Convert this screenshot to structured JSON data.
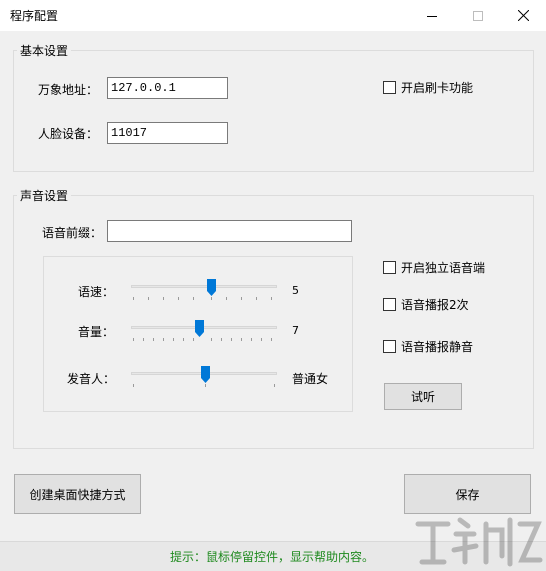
{
  "window": {
    "title": "程序配置"
  },
  "basic": {
    "group_title": "基本设置",
    "address_label": "万象地址：",
    "address_value": "127.0.0.1",
    "face_label": "人脸设备：",
    "face_value": "11017",
    "card_checkbox_label": "开启刷卡功能"
  },
  "sound": {
    "group_title": "声音设置",
    "prefix_label": "语音前缀：",
    "prefix_value": "",
    "speed_label": "语速：",
    "speed_value": "5",
    "volume_label": "音量：",
    "volume_value": "7",
    "voice_label": "发音人：",
    "voice_value": "普通女",
    "independent_label": "开启独立语音端",
    "twice_label": "语音播报2次",
    "mute_label": "语音播报静音",
    "listen_button": "试听"
  },
  "actions": {
    "shortcut_button": "创建桌面快捷方式",
    "save_button": "保存"
  },
  "status": {
    "hint": "提示：鼠标停留控件，显示帮助内容。"
  },
  "colors": {
    "accent": "#0078d7",
    "hint": "#1f8a1f",
    "background": "#f0f0f0"
  },
  "icons": [
    "minimize-icon",
    "maximize-icon",
    "close-icon",
    "slider-thumb-icon"
  ]
}
